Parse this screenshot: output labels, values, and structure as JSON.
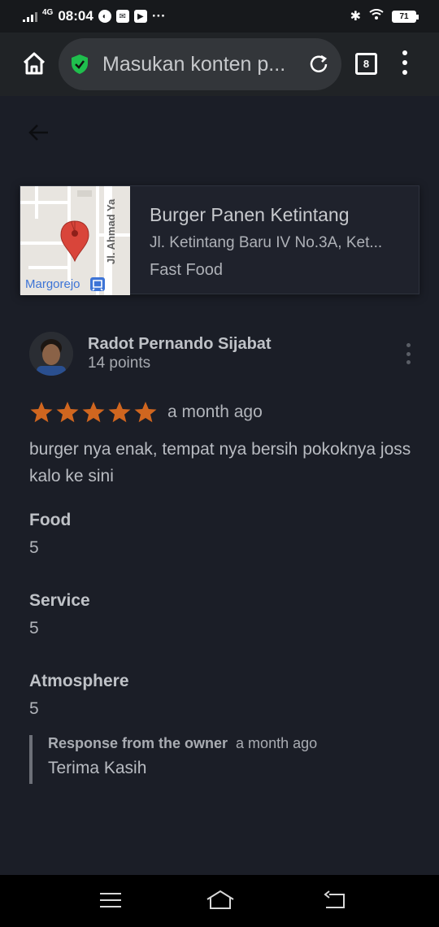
{
  "status_bar": {
    "network": "4G",
    "time": "08:04",
    "more": "···",
    "battery": "71"
  },
  "browser": {
    "url_text": "Masukan konten p...",
    "tab_count": "8"
  },
  "place": {
    "name": "Burger Panen Ketintang",
    "address": "Jl. Ketintang Baru IV No.3A, Ket...",
    "category": "Fast Food",
    "map_labels": {
      "street": "Jl. Ahmad Ya",
      "area": "Margorejo"
    }
  },
  "review": {
    "reviewer_name": "Radot Pernando Sijabat",
    "reviewer_points": "14 points",
    "rating": 5,
    "time": "a month ago",
    "text": "burger nya enak, tempat nya bersih pokoknya joss kalo ke sini",
    "aspects": [
      {
        "label": "Food",
        "value": "5"
      },
      {
        "label": "Service",
        "value": "5"
      },
      {
        "label": "Atmosphere",
        "value": "5"
      }
    ],
    "owner_response": {
      "label": "Response from the owner",
      "time": "a month ago",
      "text": "Terima Kasih"
    }
  },
  "colors": {
    "background": "#1b1e27",
    "star": "#d0661f",
    "secure_shield": "#1fbe4d",
    "map_pin": "#d9453a"
  }
}
